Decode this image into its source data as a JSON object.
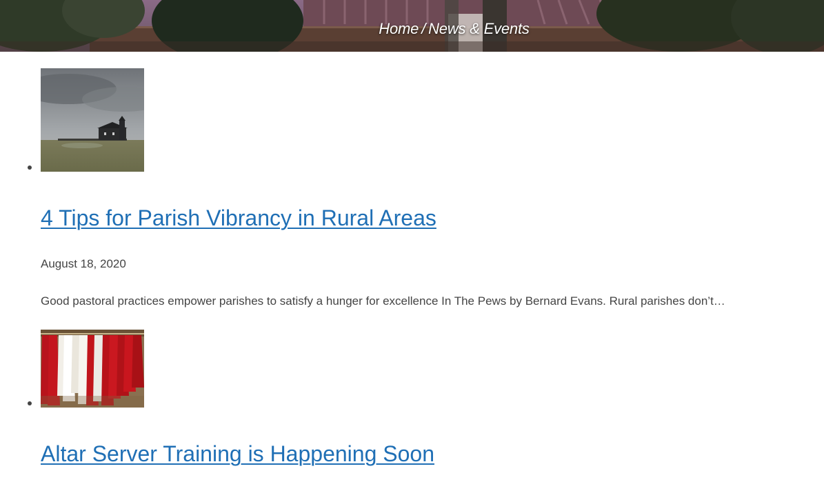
{
  "breadcrumb": {
    "home_label": "Home",
    "separator": "/",
    "current_label": "News & Events"
  },
  "posts": [
    {
      "image": "rural-church-photo",
      "title": "4 Tips for Parish Vibrancy in Rural Areas",
      "date": "August 18, 2020",
      "excerpt": "Good pastoral practices empower parishes to satisfy a hunger for excellence In The Pews by Bernard Evans. Rural parishes don’t…"
    },
    {
      "image": "altar-server-robes-photo",
      "title": "Altar Server Training is Happening Soon"
    }
  ],
  "colors": {
    "link": "#1f6fb5",
    "text": "#444444",
    "background": "#ffffff"
  }
}
